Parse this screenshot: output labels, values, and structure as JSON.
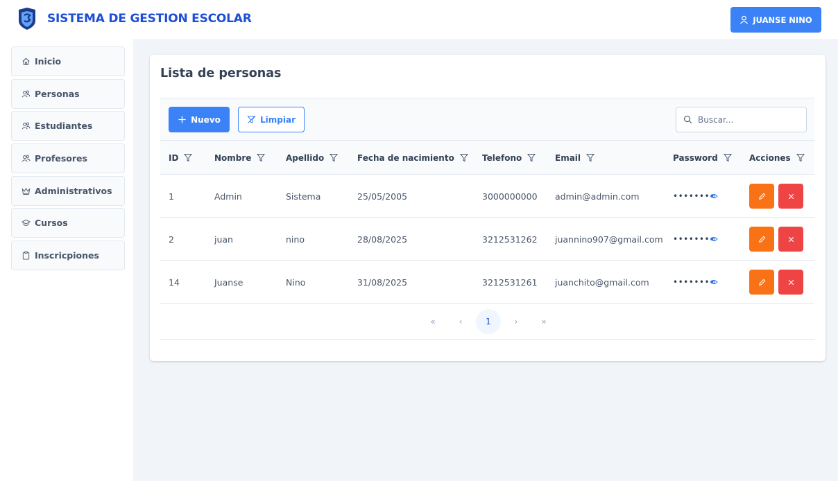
{
  "app": {
    "title": "SISTEMA DE GESTION ESCOLAR",
    "user": "JUANSE NINO"
  },
  "sidebar": {
    "items": [
      {
        "label": "Inicio",
        "icon": "home-icon"
      },
      {
        "label": "Personas",
        "icon": "users-icon"
      },
      {
        "label": "Estudiantes",
        "icon": "users-icon"
      },
      {
        "label": "Profesores",
        "icon": "users-icon"
      },
      {
        "label": "Administrativos",
        "icon": "crown-icon"
      },
      {
        "label": "Cursos",
        "icon": "graduation-cap-icon"
      },
      {
        "label": "Inscricpiones",
        "icon": "clipboard-icon"
      }
    ]
  },
  "main": {
    "title": "Lista de personas",
    "toolbar": {
      "new_label": "Nuevo",
      "clear_label": "Limpiar",
      "search_placeholder": "Buscar..."
    },
    "columns": [
      "ID",
      "Nombre",
      "Apellido",
      "Fecha de nacimiento",
      "Telefono",
      "Email",
      "Password",
      "Acciones"
    ],
    "rows": [
      {
        "id": "1",
        "nombre": "Admin",
        "apellido": "Sistema",
        "fecha": "25/05/2005",
        "telefono": "3000000000",
        "email": "admin@admin.com",
        "password": "••••••••"
      },
      {
        "id": "2",
        "nombre": "juan",
        "apellido": "nino",
        "fecha": "28/08/2025",
        "telefono": "3212531262",
        "email": "juannino907@gmail.com",
        "password": "••••••••"
      },
      {
        "id": "14",
        "nombre": "Juanse",
        "apellido": "Nino",
        "fecha": "31/08/2025",
        "telefono": "3212531261",
        "email": "juanchito@gmail.com",
        "password": "••••••••"
      }
    ],
    "pagination": {
      "first": "«",
      "prev": "‹",
      "current": "1",
      "next": "›",
      "last": "»"
    }
  },
  "colors": {
    "primary": "#3b82f6",
    "brand": "#1d4ed8",
    "edit": "#f97316",
    "delete": "#ef4444"
  }
}
